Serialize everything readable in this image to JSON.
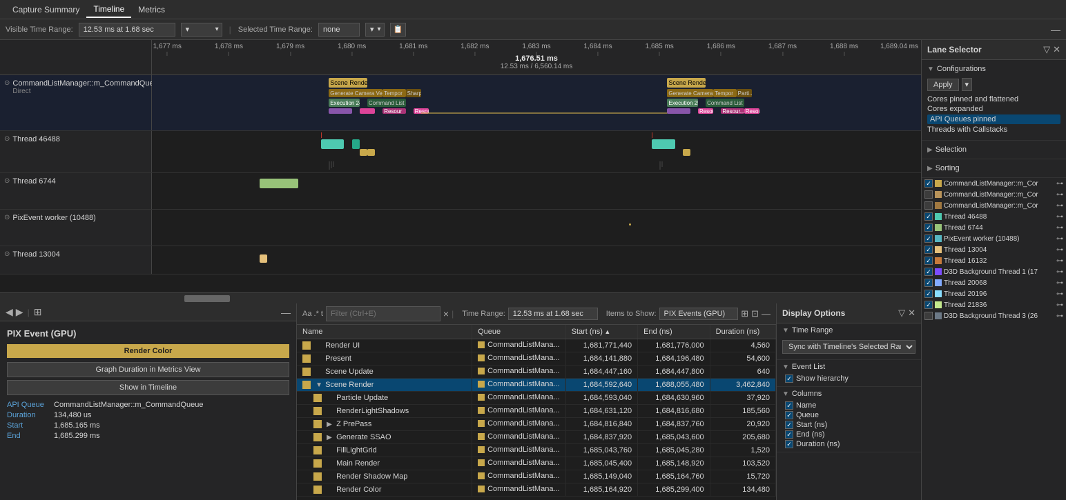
{
  "nav": {
    "items": [
      {
        "id": "capture-summary",
        "label": "Capture Summary",
        "active": false
      },
      {
        "id": "timeline",
        "label": "Timeline",
        "active": true
      },
      {
        "id": "metrics",
        "label": "Metrics",
        "active": false
      }
    ]
  },
  "toolbar": {
    "visible_time_label": "Visible Time Range:",
    "visible_time_value": "12.53 ms at 1.68 sec",
    "selected_time_label": "Selected Time Range:",
    "selected_time_value": "none",
    "minimize_label": "—"
  },
  "ruler": {
    "ticks": [
      {
        "label": "1,677 ms",
        "pos_pct": 2
      },
      {
        "label": "1,678 ms",
        "pos_pct": 10
      },
      {
        "label": "1,679 ms",
        "pos_pct": 18
      },
      {
        "label": "1,680 ms",
        "pos_pct": 26
      },
      {
        "label": "1,681 ms",
        "pos_pct": 34
      },
      {
        "label": "1,682 ms",
        "pos_pct": 42
      },
      {
        "label": "1,683 ms",
        "pos_pct": 50
      },
      {
        "label": "1,684 ms",
        "pos_pct": 58
      },
      {
        "label": "1,685 ms",
        "pos_pct": 66
      },
      {
        "label": "1,686 ms",
        "pos_pct": 74
      },
      {
        "label": "1,687 ms",
        "pos_pct": 82
      },
      {
        "label": "1,688 ms",
        "pos_pct": 90
      },
      {
        "label": "1,689.04 ms",
        "pos_pct": 98
      }
    ],
    "center_label": "1,676.51 ms",
    "center_sublabel": "12.53 ms / 6,560.14 ms"
  },
  "lanes": [
    {
      "id": "gpu-lane",
      "name": "CommandListManager::m_CommandQueue",
      "sub": "Direct",
      "color": "#c8a84b",
      "type": "gpu"
    },
    {
      "id": "thread-46488",
      "name": "Thread 46488",
      "color": "#4ec9b0",
      "type": "thread"
    },
    {
      "id": "thread-6744",
      "name": "Thread 6744",
      "color": "#98c379",
      "type": "thread"
    },
    {
      "id": "pixevent-10488",
      "name": "PixEvent worker (10488)",
      "color": "#56b6c2",
      "type": "thread"
    },
    {
      "id": "thread-13004",
      "name": "Thread 13004",
      "color": "#e5c07b",
      "type": "thread"
    }
  ],
  "lane_selector": {
    "title": "Lane Selector",
    "configurations_label": "Configurations",
    "apply_label": "Apply",
    "selection_label": "Selection",
    "sorting_label": "Sorting",
    "configs": [
      {
        "id": "cores-pinned",
        "label": "Cores pinned and flattened",
        "active": true
      },
      {
        "id": "cores-expanded",
        "label": "Cores expanded",
        "active": false
      },
      {
        "id": "api-queues",
        "label": "API Queues pinned",
        "active": false,
        "highlighted": true
      },
      {
        "id": "threads-callstacks",
        "label": "Threads with Callstacks",
        "active": false
      }
    ],
    "items": [
      {
        "id": "cmd1",
        "name": "CommandListManager::m_Cor",
        "color": "#c8a84b",
        "checked": true
      },
      {
        "id": "cmd2",
        "name": "CommandListManager::m_Cor",
        "color": "#b8935a",
        "checked": false
      },
      {
        "id": "cmd3",
        "name": "CommandListManager::m_Cor",
        "color": "#a07840",
        "checked": false
      },
      {
        "id": "t46488",
        "name": "Thread 46488",
        "color": "#4ec9b0",
        "checked": true
      },
      {
        "id": "t6744",
        "name": "Thread 6744",
        "color": "#98c379",
        "checked": true
      },
      {
        "id": "pix10488",
        "name": "PixEvent worker (10488)",
        "color": "#56b6c2",
        "checked": true
      },
      {
        "id": "t13004",
        "name": "Thread 13004",
        "color": "#e5c07b",
        "checked": true
      },
      {
        "id": "t16132",
        "name": "Thread 16132",
        "color": "#c67a3c",
        "checked": true
      },
      {
        "id": "d3d-bg1",
        "name": "D3D Background Thread 1 (17",
        "color": "#7c4dff",
        "checked": true
      },
      {
        "id": "t20068",
        "name": "Thread 20068",
        "color": "#82aaff",
        "checked": true
      },
      {
        "id": "t20196",
        "name": "Thread 20196",
        "color": "#89ddff",
        "checked": true
      },
      {
        "id": "t21836",
        "name": "Thread 21836",
        "color": "#c3e88d",
        "checked": true
      },
      {
        "id": "d3d-bg3",
        "name": "D3D Background Thread 3 (26",
        "color": "#6c7986",
        "checked": false
      }
    ]
  },
  "left_panel": {
    "title": "PIX Event (GPU)",
    "render_color_label": "Render Color",
    "graph_duration_label": "Graph Duration in Metrics View",
    "show_timeline_label": "Show in Timeline",
    "fields": [
      {
        "key": "API Queue",
        "value": "CommandListManager::m_CommandQueue"
      },
      {
        "key": "Duration",
        "value": "134,480 us"
      },
      {
        "key": "Start",
        "value": "1,685.165 ms"
      },
      {
        "key": "End",
        "value": "1,685.299 ms"
      }
    ]
  },
  "filter_bar": {
    "toggles": "Aa .* t",
    "placeholder": "Filter (Ctrl+E)",
    "clear_label": "×",
    "time_range_label": "Time Range:",
    "time_range_value": "12.53 ms at 1.68 sec",
    "items_label": "Items to Show:",
    "items_value": "PIX Events (GPU)"
  },
  "event_table": {
    "columns": [
      {
        "id": "name",
        "label": "Name"
      },
      {
        "id": "queue",
        "label": "Queue"
      },
      {
        "id": "start",
        "label": "Start (ns)",
        "sorted": "asc"
      },
      {
        "id": "end",
        "label": "End (ns)"
      },
      {
        "id": "duration",
        "label": "Duration (ns)"
      }
    ],
    "rows": [
      {
        "id": 1,
        "indent": 0,
        "expandable": false,
        "icon_color": "#c8a84b",
        "name": "Render UI",
        "queue": "CommandListMana...",
        "queue_color": "#c8a84b",
        "start": "1,681,771,440",
        "end": "1,681,776,000",
        "duration": "4,560"
      },
      {
        "id": 2,
        "indent": 0,
        "expandable": false,
        "icon_color": "#c8a84b",
        "name": "Present",
        "queue": "CommandListMana...",
        "queue_color": "#c8a84b",
        "start": "1,684,141,880",
        "end": "1,684,196,480",
        "duration": "54,600"
      },
      {
        "id": 3,
        "indent": 0,
        "expandable": false,
        "icon_color": "#c8a84b",
        "name": "Scene Update",
        "queue": "CommandListMana...",
        "queue_color": "#c8a84b",
        "start": "1,684,447,160",
        "end": "1,684,447,800",
        "duration": "640"
      },
      {
        "id": 4,
        "indent": 0,
        "expandable": true,
        "expanded": true,
        "icon_color": "#c8a84b",
        "name": "Scene Render",
        "queue": "CommandListMana...",
        "queue_color": "#c8a84b",
        "start": "1,684,592,640",
        "end": "1,688,055,480",
        "duration": "3,462,840",
        "selected": true
      },
      {
        "id": 5,
        "indent": 1,
        "expandable": false,
        "icon_color": "#c8a84b",
        "name": "Particle Update",
        "queue": "CommandListMana...",
        "queue_color": "#c8a84b",
        "start": "1,684,593,040",
        "end": "1,684,630,960",
        "duration": "37,920"
      },
      {
        "id": 6,
        "indent": 1,
        "expandable": false,
        "icon_color": "#c8a84b",
        "name": "RenderLightShadows",
        "queue": "CommandListMana...",
        "queue_color": "#c8a84b",
        "start": "1,684,631,120",
        "end": "1,684,816,680",
        "duration": "185,560"
      },
      {
        "id": 7,
        "indent": 1,
        "expandable": true,
        "expanded": false,
        "icon_color": "#c8a84b",
        "name": "Z PrePass",
        "queue": "CommandListMana...",
        "queue_color": "#c8a84b",
        "start": "1,684,816,840",
        "end": "1,684,837,760",
        "duration": "20,920"
      },
      {
        "id": 8,
        "indent": 1,
        "expandable": true,
        "expanded": false,
        "icon_color": "#c8a84b",
        "name": "Generate SSAO",
        "queue": "CommandListMana...",
        "queue_color": "#c8a84b",
        "start": "1,684,837,920",
        "end": "1,685,043,600",
        "duration": "205,680"
      },
      {
        "id": 9,
        "indent": 1,
        "expandable": false,
        "icon_color": "#c8a84b",
        "name": "FillLightGrid",
        "queue": "CommandListMana...",
        "queue_color": "#c8a84b",
        "start": "1,685,043,760",
        "end": "1,685,045,280",
        "duration": "1,520"
      },
      {
        "id": 10,
        "indent": 1,
        "expandable": false,
        "icon_color": "#c8a84b",
        "name": "Main Render",
        "queue": "CommandListMana...",
        "queue_color": "#c8a84b",
        "start": "1,685,045,400",
        "end": "1,685,148,920",
        "duration": "103,520"
      },
      {
        "id": 11,
        "indent": 1,
        "expandable": false,
        "icon_color": "#c8a84b",
        "name": "Render Shadow Map",
        "queue": "CommandListMana...",
        "queue_color": "#c8a84b",
        "start": "1,685,149,040",
        "end": "1,685,164,760",
        "duration": "15,720"
      },
      {
        "id": 12,
        "indent": 1,
        "expandable": false,
        "icon_color": "#c8a84b",
        "name": "Render Color",
        "queue": "CommandListMana...",
        "queue_color": "#c8a84b",
        "start": "1,685,164,920",
        "end": "1,685,299,400",
        "duration": "134,480"
      }
    ]
  },
  "display_options": {
    "title": "Display Options",
    "time_range_label": "Time Range",
    "time_range_value": "Sync with Timeline's Selected Range",
    "event_list_label": "Event List",
    "show_hierarchy_label": "Show hierarchy",
    "columns_label": "Columns",
    "columns": [
      {
        "id": "col-name",
        "label": "Name",
        "checked": true
      },
      {
        "id": "col-queue",
        "label": "Queue",
        "checked": true
      },
      {
        "id": "col-start",
        "label": "Start (ns)",
        "checked": true
      },
      {
        "id": "col-end",
        "label": "End (ns)",
        "checked": true
      },
      {
        "id": "col-duration",
        "label": "Duration (ns)",
        "checked": true
      }
    ]
  }
}
